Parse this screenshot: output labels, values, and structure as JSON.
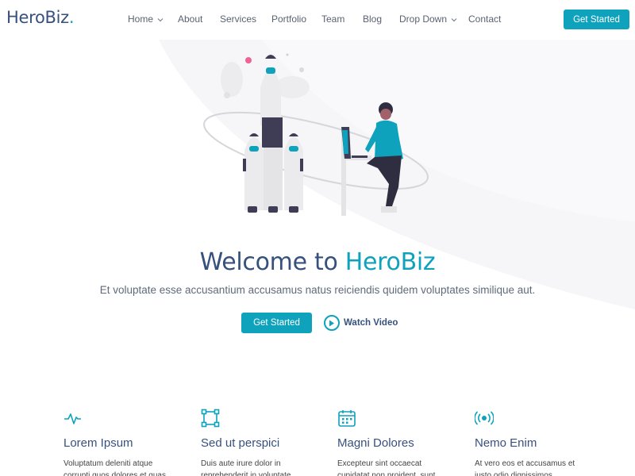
{
  "header": {
    "logo_text": "HeroBiz",
    "logo_dot": ".",
    "nav": [
      {
        "label": "Home",
        "dropdown": true
      },
      {
        "label": "About",
        "dropdown": false
      },
      {
        "label": "Services",
        "dropdown": false
      },
      {
        "label": "Portfolio",
        "dropdown": false
      },
      {
        "label": "Team",
        "dropdown": false
      },
      {
        "label": "Blog",
        "dropdown": false
      },
      {
        "label": "Drop Down",
        "dropdown": true
      },
      {
        "label": "Contact",
        "dropdown": false
      }
    ],
    "cta_label": "Get Started"
  },
  "hero": {
    "title_prefix": "Welcome to ",
    "title_accent": "HeroBiz",
    "subtitle": "Et voluptate esse accusantium accusamus natus reiciendis quidem voluptates similique aut.",
    "primary_button": "Get Started",
    "video_button": "Watch Video"
  },
  "features": [
    {
      "icon": "activity-icon",
      "title": "Lorem Ipsum",
      "text": "Voluptatum deleniti atque corrupti quos dolores et quas"
    },
    {
      "icon": "bounding-box-icon",
      "title": "Sed ut perspici",
      "text": "Duis aute irure dolor in reprehenderit in voluptate"
    },
    {
      "icon": "calendar-icon",
      "title": "Magni Dolores",
      "text": "Excepteur sint occaecat cupidatat non proident, sunt"
    },
    {
      "icon": "broadcast-icon",
      "title": "Nemo Enim",
      "text": "At vero eos et accusamus et iusto odio dignissimos"
    }
  ],
  "colors": {
    "accent": "#0ea2bd",
    "heading": "#37517e",
    "text": "#444444"
  }
}
